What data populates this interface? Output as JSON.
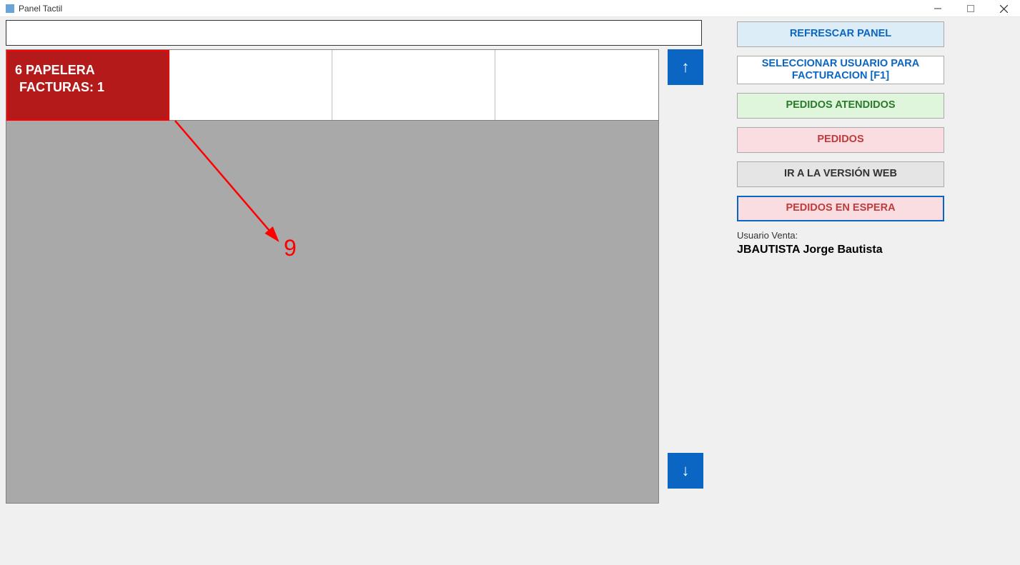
{
  "window": {
    "title": "Panel Tactil"
  },
  "search": {
    "value": ""
  },
  "card": {
    "line1": "6 PAPELERA",
    "line2": "FACTURAS: 1"
  },
  "annotation": {
    "number": "9"
  },
  "scroll": {
    "up": "↑",
    "down": "↓"
  },
  "sidebar": {
    "refresh": "REFRESCAR PANEL",
    "select_user": "SELECCIONAR USUARIO PARA FACTURACION [F1]",
    "attended": "PEDIDOS ATENDIDOS",
    "pedidos": "PEDIDOS",
    "web": "IR A LA VERSIÓN WEB",
    "waiting": "PEDIDOS EN ESPERA",
    "user_label": "Usuario Venta:",
    "user_name": "JBAUTISTA Jorge Bautista"
  }
}
